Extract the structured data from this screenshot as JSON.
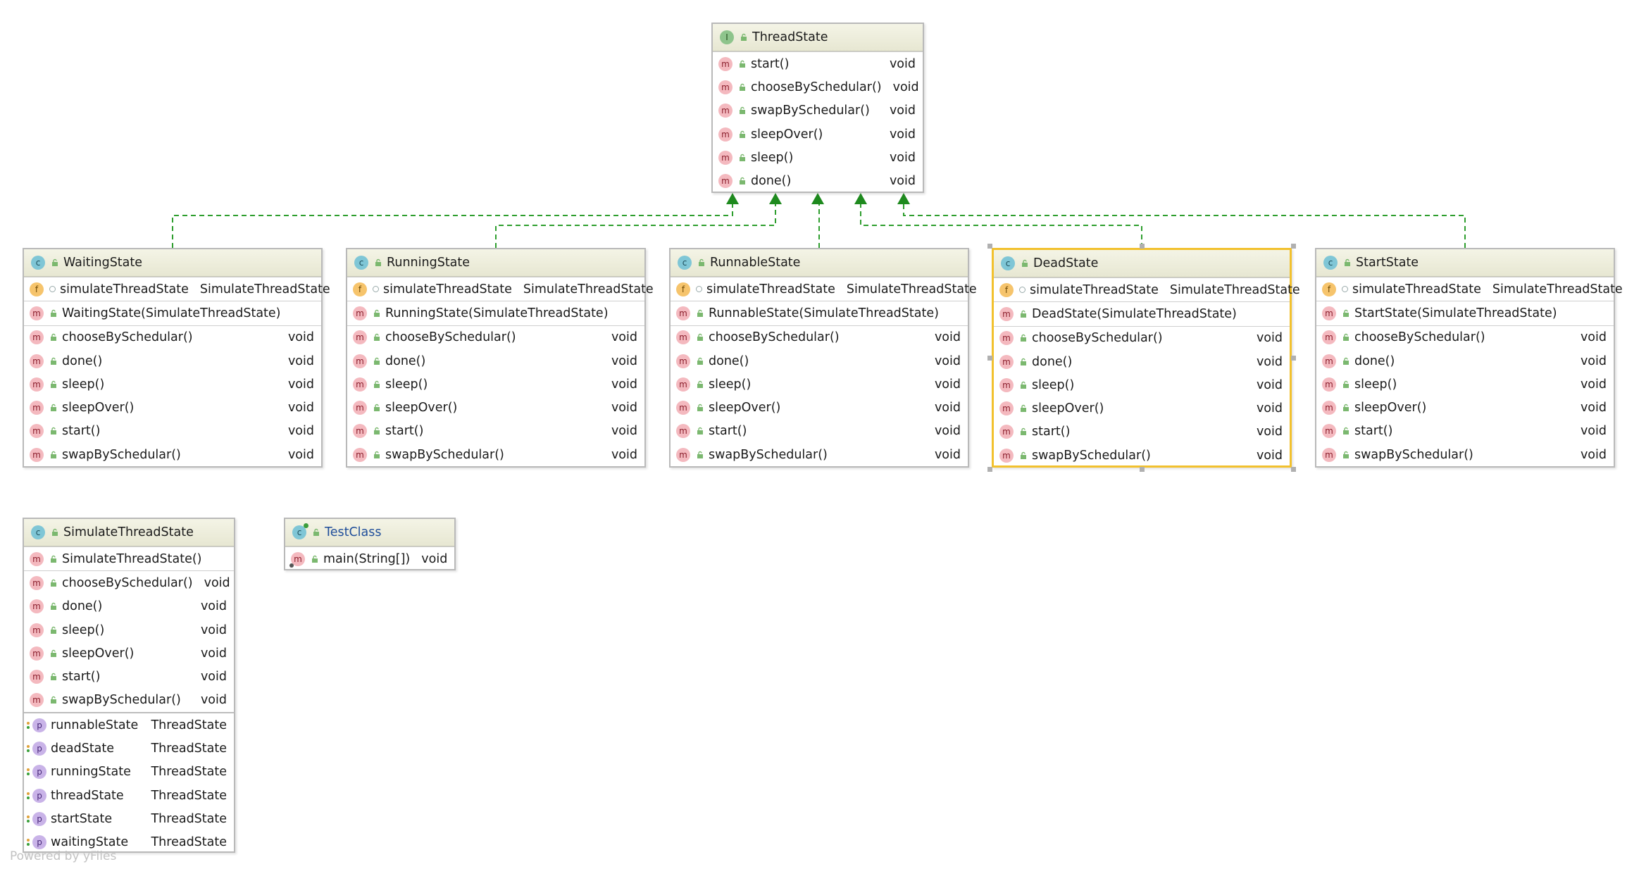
{
  "footer": "Powered by yFiles",
  "colors": {
    "edge": "#2e9e2e",
    "arrow": "#1e8a1e",
    "selection": "#f2c12e"
  },
  "interface": {
    "name": "ThreadState",
    "kind": "I",
    "methods": [
      {
        "name": "start()",
        "type": "void"
      },
      {
        "name": "chooseBySchedular()",
        "type": "void"
      },
      {
        "name": "swapBySchedular()",
        "type": "void"
      },
      {
        "name": "sleepOver()",
        "type": "void"
      },
      {
        "name": "sleep()",
        "type": "void"
      },
      {
        "name": "done()",
        "type": "void"
      }
    ]
  },
  "states": [
    {
      "name": "WaitingState",
      "field": "simulateThreadState",
      "field_type": "SimulateThreadState",
      "constructor": "WaitingState(SimulateThreadState)",
      "methods": [
        {
          "name": "chooseBySchedular()",
          "type": "void"
        },
        {
          "name": "done()",
          "type": "void"
        },
        {
          "name": "sleep()",
          "type": "void"
        },
        {
          "name": "sleepOver()",
          "type": "void"
        },
        {
          "name": "start()",
          "type": "void"
        },
        {
          "name": "swapBySchedular()",
          "type": "void"
        }
      ]
    },
    {
      "name": "RunningState",
      "field": "simulateThreadState",
      "field_type": "SimulateThreadState",
      "constructor": "RunningState(SimulateThreadState)",
      "methods": [
        {
          "name": "chooseBySchedular()",
          "type": "void"
        },
        {
          "name": "done()",
          "type": "void"
        },
        {
          "name": "sleep()",
          "type": "void"
        },
        {
          "name": "sleepOver()",
          "type": "void"
        },
        {
          "name": "start()",
          "type": "void"
        },
        {
          "name": "swapBySchedular()",
          "type": "void"
        }
      ]
    },
    {
      "name": "RunnableState",
      "field": "simulateThreadState",
      "field_type": "SimulateThreadState",
      "constructor": "RunnableState(SimulateThreadState)",
      "methods": [
        {
          "name": "chooseBySchedular()",
          "type": "void"
        },
        {
          "name": "done()",
          "type": "void"
        },
        {
          "name": "sleep()",
          "type": "void"
        },
        {
          "name": "sleepOver()",
          "type": "void"
        },
        {
          "name": "start()",
          "type": "void"
        },
        {
          "name": "swapBySchedular()",
          "type": "void"
        }
      ]
    },
    {
      "name": "DeadState",
      "field": "simulateThreadState",
      "field_type": "SimulateThreadState",
      "constructor": "DeadState(SimulateThreadState)",
      "methods": [
        {
          "name": "chooseBySchedular()",
          "type": "void"
        },
        {
          "name": "done()",
          "type": "void"
        },
        {
          "name": "sleep()",
          "type": "void"
        },
        {
          "name": "sleepOver()",
          "type": "void"
        },
        {
          "name": "start()",
          "type": "void"
        },
        {
          "name": "swapBySchedular()",
          "type": "void"
        }
      ]
    },
    {
      "name": "StartState",
      "field": "simulateThreadState",
      "field_type": "SimulateThreadState",
      "constructor": "StartState(SimulateThreadState)",
      "methods": [
        {
          "name": "chooseBySchedular()",
          "type": "void"
        },
        {
          "name": "done()",
          "type": "void"
        },
        {
          "name": "sleep()",
          "type": "void"
        },
        {
          "name": "sleepOver()",
          "type": "void"
        },
        {
          "name": "start()",
          "type": "void"
        },
        {
          "name": "swapBySchedular()",
          "type": "void"
        }
      ]
    }
  ],
  "simulate": {
    "name": "SimulateThreadState",
    "constructor": "SimulateThreadState()",
    "methods": [
      {
        "name": "chooseBySchedular()",
        "type": "void"
      },
      {
        "name": "done()",
        "type": "void"
      },
      {
        "name": "sleep()",
        "type": "void"
      },
      {
        "name": "sleepOver()",
        "type": "void"
      },
      {
        "name": "start()",
        "type": "void"
      },
      {
        "name": "swapBySchedular()",
        "type": "void"
      }
    ],
    "properties": [
      {
        "name": "runnableState",
        "type": "ThreadState"
      },
      {
        "name": "deadState",
        "type": "ThreadState"
      },
      {
        "name": "runningState",
        "type": "ThreadState"
      },
      {
        "name": "threadState",
        "type": "ThreadState"
      },
      {
        "name": "startState",
        "type": "ThreadState"
      },
      {
        "name": "waitingState",
        "type": "ThreadState"
      }
    ]
  },
  "test": {
    "name": "TestClass",
    "methods": [
      {
        "name": "main(String[])",
        "type": "void"
      }
    ]
  }
}
